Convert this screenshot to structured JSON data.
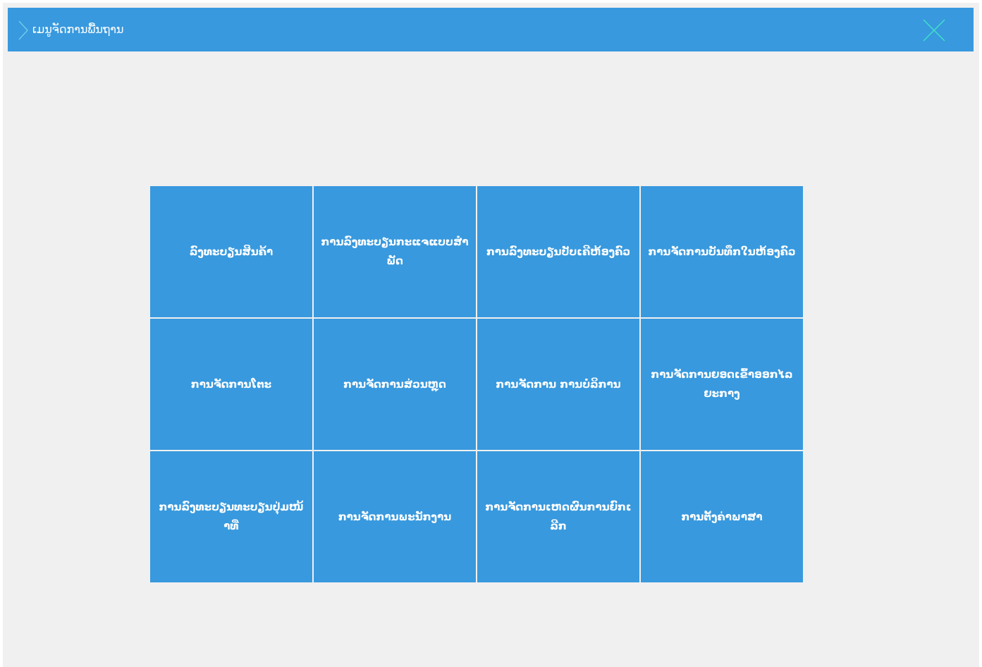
{
  "header": {
    "title": "ເມນູຈັດການພື້ນຖານ",
    "back_icon": "chevron-right-icon",
    "close_icon": "close-icon",
    "colors": {
      "bar": "#3899de",
      "close_icon": "#3fe0c8",
      "chevron": "#7dd7ea"
    }
  },
  "menu": {
    "tiles": [
      {
        "label": "ລົງທະບຽນສິນຄ້າ"
      },
      {
        "label": "ການລົງທະບຽນກະແຈແບບສໍາພັດ"
      },
      {
        "label": "ການລົງທະບຽນປັບເຄີຫ້ອງຄົວ"
      },
      {
        "label": "ການຈັດການບັນທຶກໃນຫ້ອງຄົວ"
      },
      {
        "label": "ການຈັດການໂຕະ"
      },
      {
        "label": "ການຈັດການສ່ວນຫຼຸດ"
      },
      {
        "label": "ການຈັດການ ການບໍລິການ"
      },
      {
        "label": "ການຈັດການຍອດເຂົ້າອອກໄລຍະກາງ"
      },
      {
        "label": "ການລົງທະບຽນທະບຽນປຸ່ມໜ້າທີ່"
      },
      {
        "label": "ການຈັດການພະນັກງານ"
      },
      {
        "label": "ການຈັດການເຫດຜົນການຍົກເລີກ"
      },
      {
        "label": "ການຕັ້ງຄ່າພາສາ"
      }
    ],
    "tile_color": "#3899de"
  }
}
